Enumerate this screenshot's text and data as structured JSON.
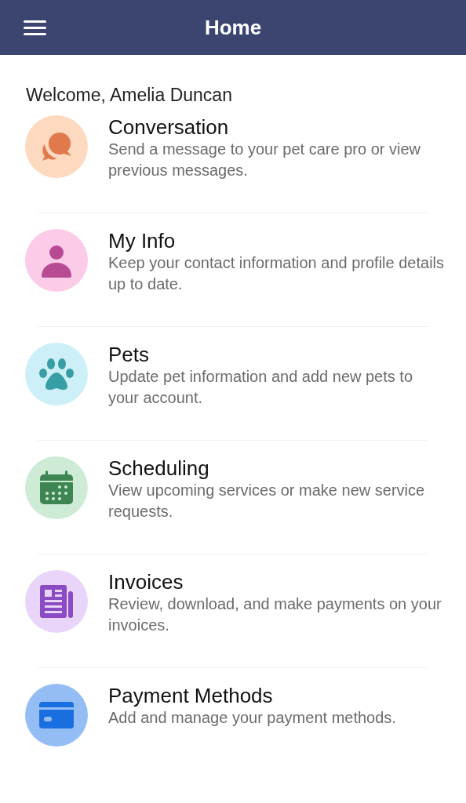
{
  "header": {
    "title": "Home"
  },
  "welcome": "Welcome, Amelia Duncan",
  "items": [
    {
      "kind": "chat",
      "title": "Conversation",
      "description": "Send a message to your pet care pro or view previous messages."
    },
    {
      "kind": "person",
      "title": "My Info",
      "description": "Keep your contact information and profile details up to date."
    },
    {
      "kind": "paw",
      "title": "Pets",
      "description": "Update pet information and add new pets to your account."
    },
    {
      "kind": "calendar",
      "title": "Scheduling",
      "description": "View upcoming services or make new service requests."
    },
    {
      "kind": "invoice",
      "title": "Invoices",
      "description": "Review, download, and make payments on your invoices."
    },
    {
      "kind": "card",
      "title": "Payment Methods",
      "description": "Add and manage your payment methods."
    }
  ]
}
